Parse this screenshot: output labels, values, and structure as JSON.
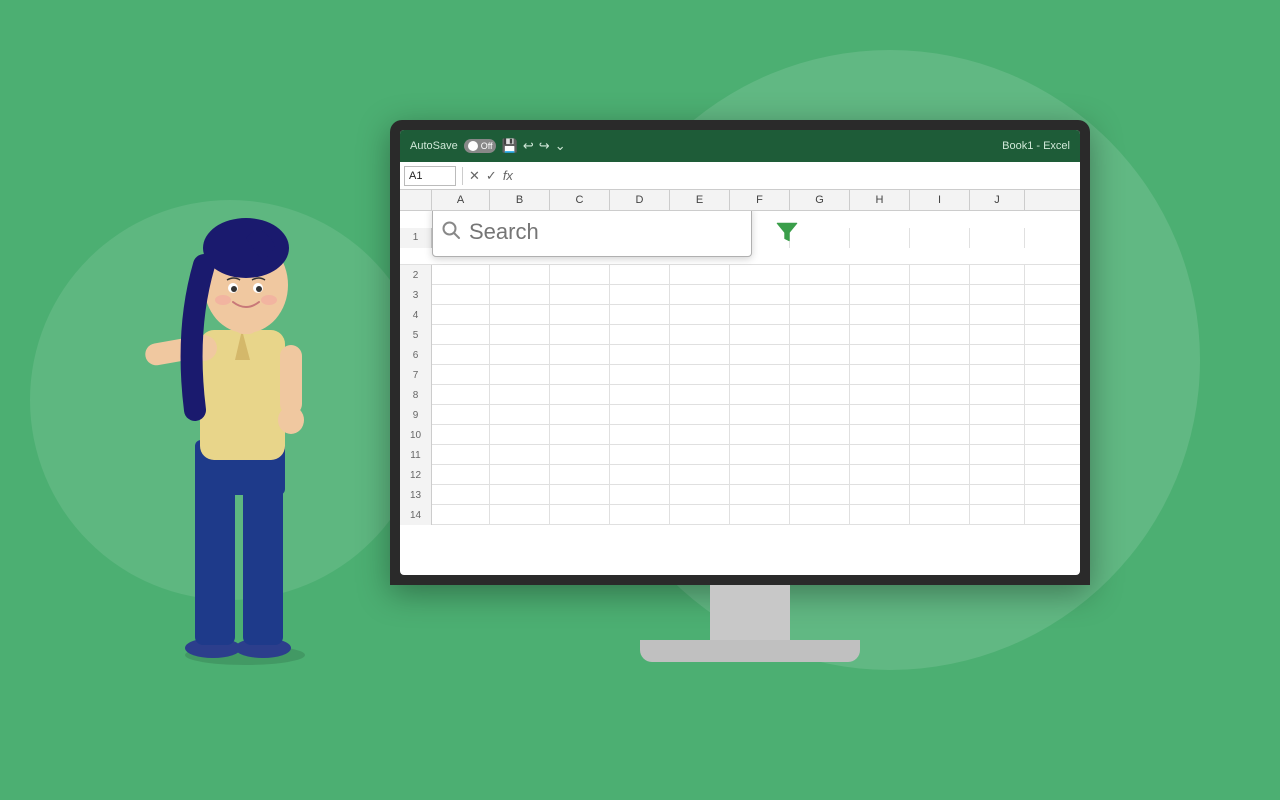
{
  "background": {
    "color": "#4caf72"
  },
  "excel": {
    "titlebar": {
      "autosave_label": "AutoSave",
      "toggle_state": "Off",
      "title": "Book1 - Excel"
    },
    "formula_bar": {
      "cell_ref": "A1",
      "formula": ""
    },
    "columns": [
      "A",
      "B",
      "C",
      "D",
      "E",
      "F",
      "G",
      "H",
      "I",
      "J"
    ],
    "rows": [
      1,
      2,
      3,
      4,
      5,
      6,
      7,
      8,
      9,
      10,
      11,
      12,
      13,
      14
    ]
  },
  "search": {
    "placeholder": "Search",
    "filter_icon_label": "filter-icon"
  },
  "toolbar": {
    "icons": [
      "💾",
      "↩",
      "↪",
      "⌄"
    ]
  }
}
